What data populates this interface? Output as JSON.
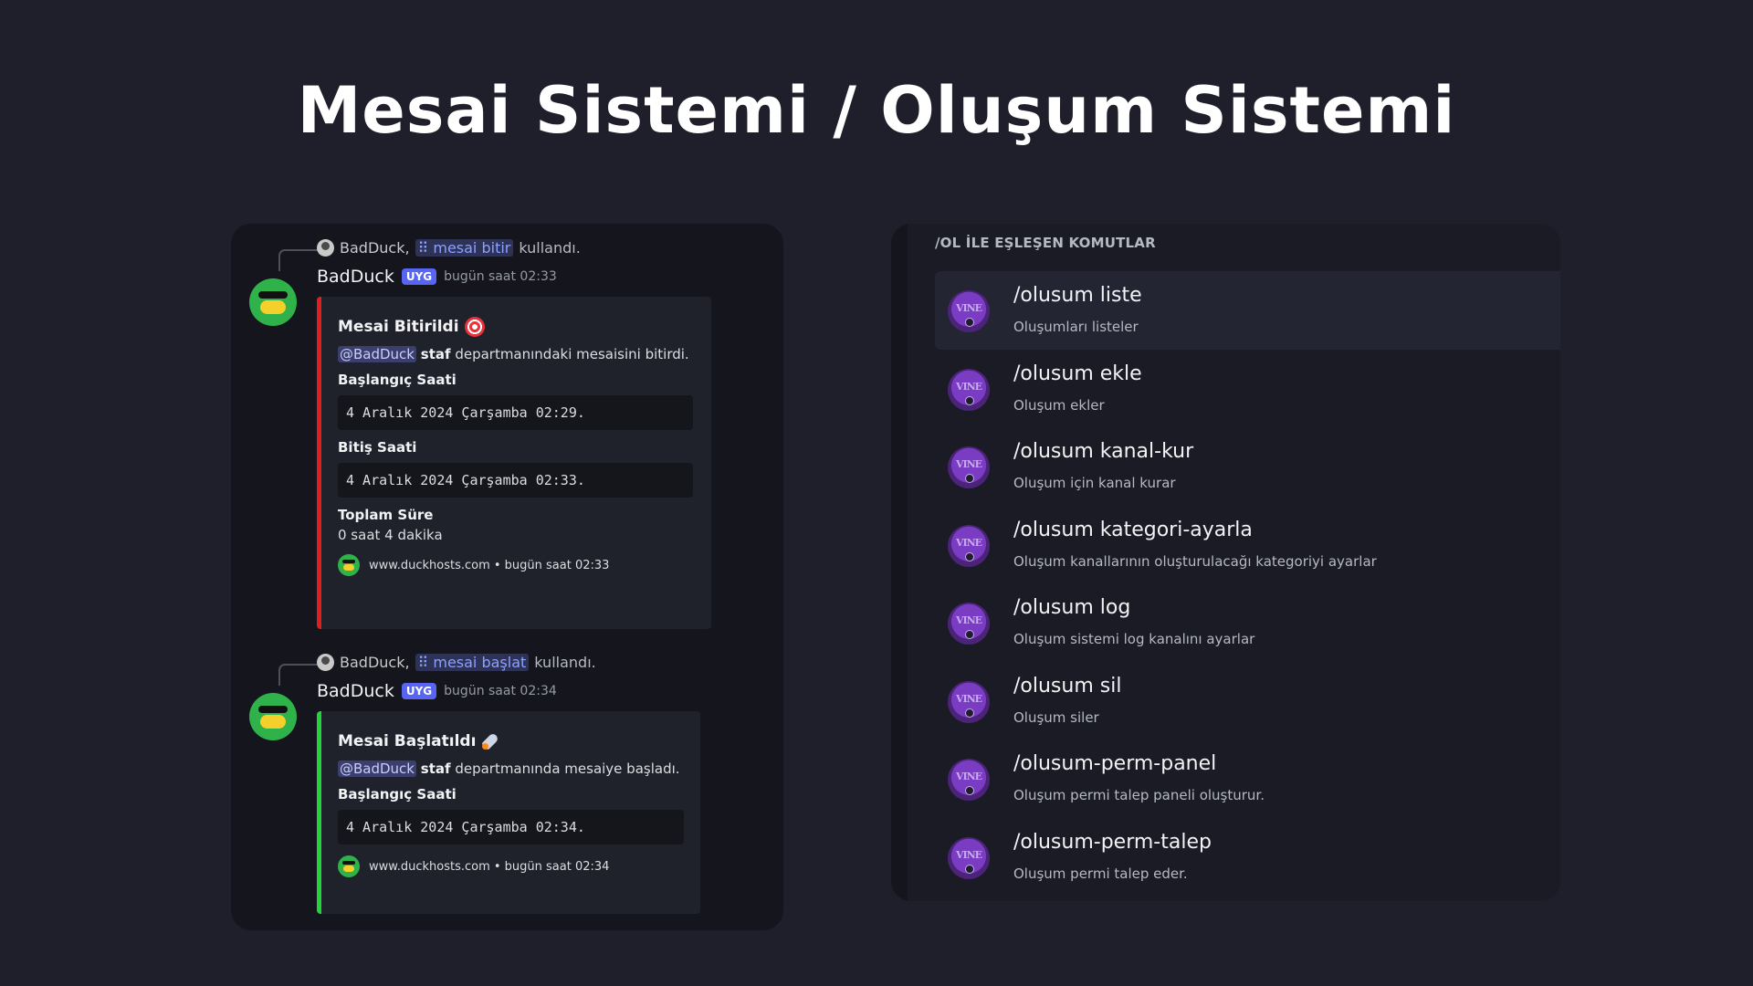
{
  "title": "Mesai Sistemi / Oluşum Sistemi",
  "left_panel": {
    "messages": [
      {
        "reply_user": "BadDuck,",
        "reply_command": "mesai bitir",
        "reply_suffix": "kullandı.",
        "author": "BadDuck",
        "badge": "UYG",
        "timestamp": "bugün saat 02:33",
        "embed": {
          "title": "Mesai Bitirildi",
          "emoji": "target-emoji",
          "mention": "@BadDuck",
          "desc_bold": "staf",
          "desc_rest": "departmanındaki mesaisini bitirdi.",
          "fields": [
            {
              "name": "Başlangıç Saati",
              "code": "4 Aralık 2024 Çarşamba 02:29."
            },
            {
              "name": "Bitiş Saati",
              "code": "4 Aralık 2024 Çarşamba 02:33."
            },
            {
              "name": "Toplam Süre",
              "value": "0 saat 4 dakika"
            }
          ],
          "footer": "www.duckhosts.com • bugün saat 02:33",
          "color": "#e01e1e"
        }
      },
      {
        "reply_user": "BadDuck,",
        "reply_command": "mesai başlat",
        "reply_suffix": "kullandı.",
        "author": "BadDuck",
        "badge": "UYG",
        "timestamp": "bugün saat 02:34",
        "embed": {
          "title": "Mesai Başlatıldı",
          "emoji": "rocket-emoji",
          "mention": "@BadDuck",
          "desc_bold": "staf",
          "desc_rest": "departmanında mesaiye başladı.",
          "fields": [
            {
              "name": "Başlangıç Saati",
              "code": "4 Aralık 2024 Çarşamba 02:34."
            }
          ],
          "footer": "www.duckhosts.com • bugün saat 02:34",
          "color": "#22d33a"
        }
      }
    ]
  },
  "right_panel": {
    "header": "/OL İLE EŞLEŞEN KOMUTLAR",
    "icon_text": "VINE",
    "commands": [
      {
        "name": "/olusum liste",
        "desc": "Oluşumları listeler"
      },
      {
        "name": "/olusum ekle",
        "desc": "Oluşum ekler"
      },
      {
        "name": "/olusum kanal-kur",
        "desc": "Oluşum için kanal kurar"
      },
      {
        "name": "/olusum kategori-ayarla",
        "desc": "Oluşum kanallarının oluşturulacağı kategoriyi ayarlar"
      },
      {
        "name": "/olusum log",
        "desc": "Oluşum sistemi log kanalını ayarlar"
      },
      {
        "name": "/olusum sil",
        "desc": "Oluşum siler"
      },
      {
        "name": "/olusum-perm-panel",
        "desc": "Oluşum permi talep paneli oluşturur."
      },
      {
        "name": "/olusum-perm-talep",
        "desc": "Oluşum permi talep eder."
      }
    ]
  }
}
